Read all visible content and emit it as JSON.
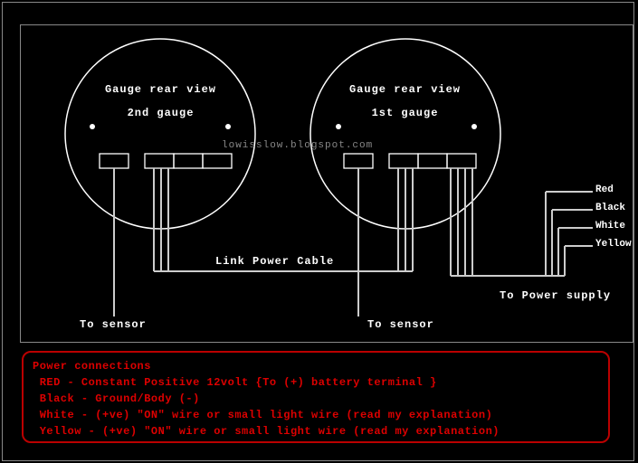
{
  "gauge2": {
    "title": "Gauge rear view",
    "sub": "2nd gauge"
  },
  "gauge1": {
    "title": "Gauge rear view",
    "sub": "1st gauge"
  },
  "watermark": "lowisslow.blogspot.com",
  "labels": {
    "link": "Link Power Cable",
    "sensor": "To sensor",
    "supply": "To Power supply"
  },
  "wires": {
    "red": "Red",
    "black": "Black",
    "white": "White",
    "yellow": "Yellow"
  },
  "power": {
    "heading": "Power connections",
    "red": " RED - Constant Positive 12volt {To (+) battery terminal }",
    "black": " Black - Ground/Body (-)",
    "white": " White - (+ve) \"ON\" wire or small light wire (read my explanation)",
    "yellow": " Yellow - (+ve) \"ON\" wire or small light wire (read my explanation)"
  }
}
